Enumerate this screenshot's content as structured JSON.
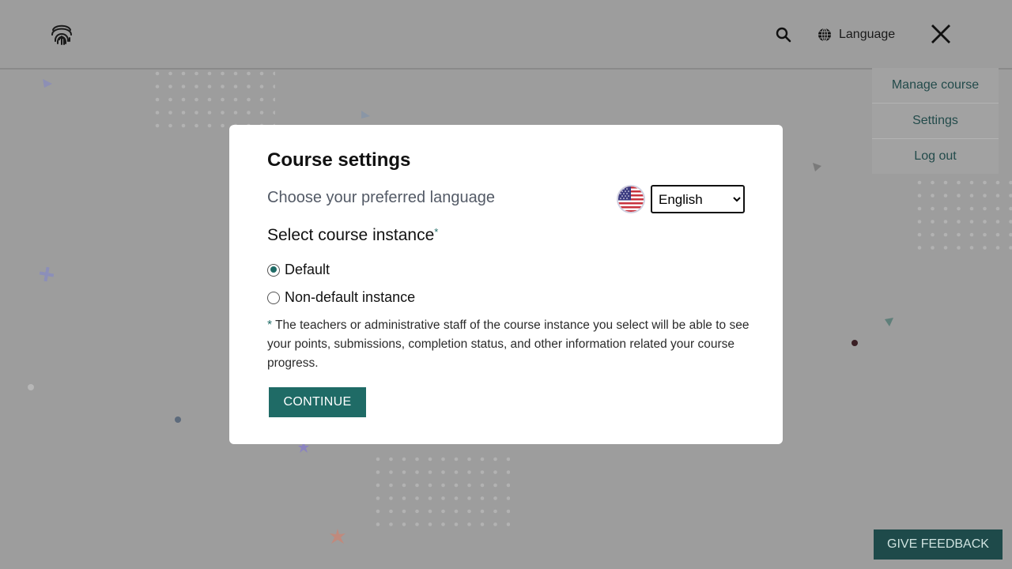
{
  "header": {
    "language_label": "Language"
  },
  "side_menu": {
    "items": [
      {
        "label": "Manage course"
      },
      {
        "label": "Settings"
      },
      {
        "label": "Log out"
      }
    ]
  },
  "modal": {
    "title": "Course settings",
    "language_prompt": "Choose your preferred language",
    "language_selected": "English",
    "instance_title": "Select course instance",
    "required_marker": "*",
    "options": [
      {
        "label": "Default",
        "checked": true
      },
      {
        "label": "Non-default instance",
        "checked": false
      }
    ],
    "note_marker": "*",
    "note_text": " The teachers or administrative staff of the course instance you select will be able to see your points, submissions, completion status, and other information related your course progress.",
    "continue_label": "CONTINUE"
  },
  "feedback_label": "GIVE FEEDBACK",
  "icons": {
    "logo": "fingerprint-icon",
    "search": "search-icon",
    "language": "globe-icon",
    "close": "close-icon",
    "flag": "us-flag-icon"
  },
  "colors": {
    "accent": "#1f6b66",
    "overlay": "#9d9d9d",
    "feedback": "#1e4a4a"
  }
}
